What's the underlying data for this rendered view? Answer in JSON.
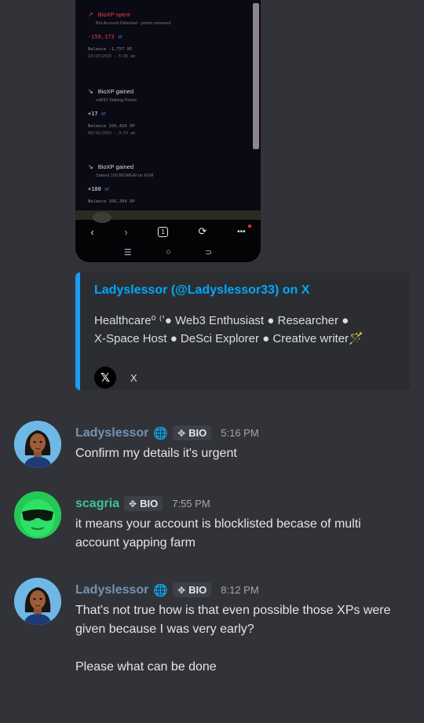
{
  "phone": {
    "transactions": [
      {
        "title": "BioXP spent",
        "desc": "Bot Account Detected - points removed",
        "amount": "-159,173",
        "unit": "XP",
        "balance": "Balance -1,757 XP",
        "date": "10/10/2025 - 6:06 am"
      },
      {
        "title": "BioXP gained",
        "desc": "veBIO Staking Points",
        "amount": "+17",
        "unit": "XP",
        "balance": "Balance 156,416 XP",
        "date": "09/10/2025 - 9:53 am"
      },
      {
        "title": "BioXP gained",
        "desc": "Staked 100 BIOMEAI on EVM",
        "amount": "+100",
        "unit": "XP",
        "balance": "Balance 156,399 XP",
        "date": ""
      }
    ],
    "nav": {
      "back": "‹",
      "forward": "›",
      "tabs": "1",
      "reload": "⟳",
      "menu": "•••"
    },
    "system": {
      "recents": "☰",
      "home": "○",
      "back": "⊃"
    }
  },
  "embed": {
    "title": "Ladyslessor (@Ladyslessor33) on X",
    "description": "Healthcare⁰ ⁽ʼ● Web3 Enthusiast ● Researcher ●\nX-Space Host ● DeSci Explorer ● Creative writer🪄",
    "footer_logo": "𝕏",
    "footer_text": "X"
  },
  "messages": [
    {
      "author": "Ladyslessor",
      "author_suffix": "🌐",
      "tag": "BIO",
      "time": "5:16 PM",
      "lines": [
        "Confirm my details it's urgent"
      ]
    },
    {
      "author": "scagria",
      "author_suffix": "",
      "tag": "BIO",
      "time": "7:55 PM",
      "lines": [
        "it means your account is blocklisted becase of multi account yapping farm"
      ]
    },
    {
      "author": "Ladyslessor",
      "author_suffix": "🌐",
      "tag": "BIO",
      "time": "8:12 PM",
      "lines": [
        "That's not true how is that even possible those XPs were given because I was very early?",
        "Please what can be done"
      ]
    }
  ],
  "colors": {
    "background": "#323339",
    "embed_bar": "#1d9bf0",
    "embed_title": "#00a8fc",
    "user_blue": "#7293b3",
    "user_teal": "#3ec494"
  }
}
